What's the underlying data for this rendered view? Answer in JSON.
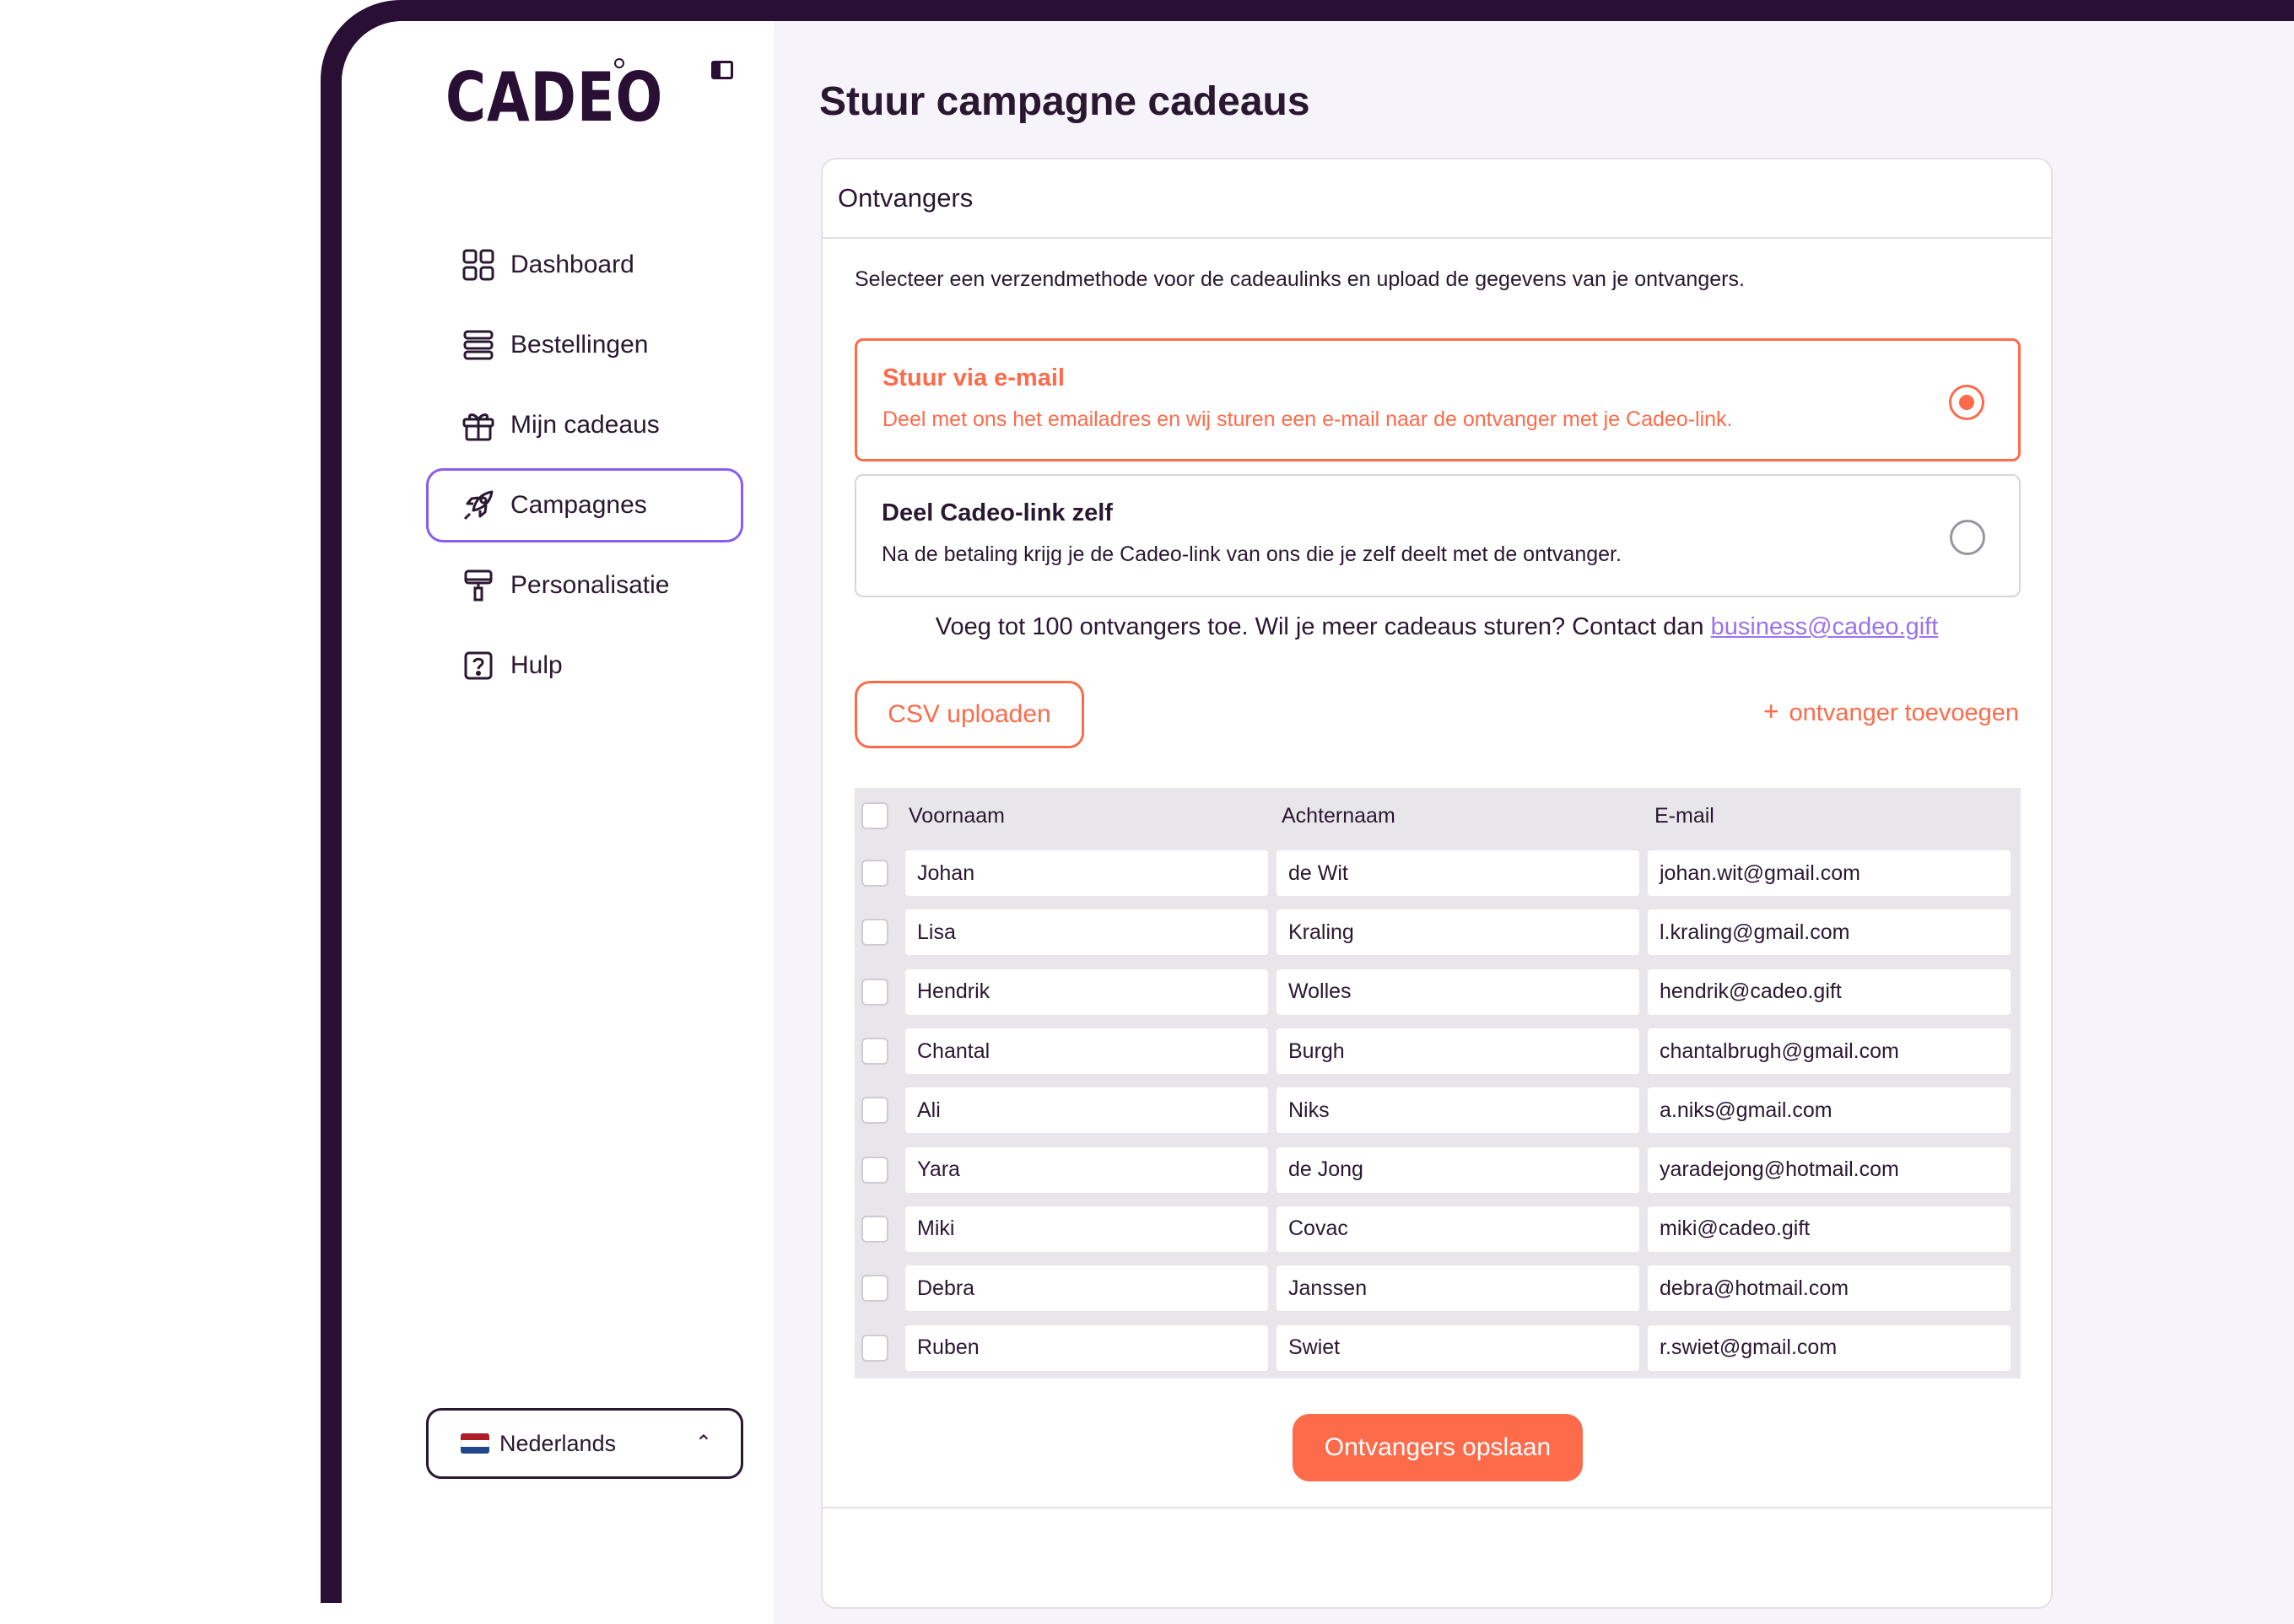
{
  "brand": {
    "logo": "CADEO"
  },
  "sidebar": {
    "items": [
      {
        "label": "Dashboard",
        "icon": "grid-icon"
      },
      {
        "label": "Bestellingen",
        "icon": "list-icon"
      },
      {
        "label": "Mijn cadeaus",
        "icon": "gift-icon"
      },
      {
        "label": "Campagnes",
        "icon": "rocket-icon",
        "active": true
      },
      {
        "label": "Personalisatie",
        "icon": "paint-roller-icon"
      },
      {
        "label": "Hulp",
        "icon": "help-icon"
      }
    ],
    "language": {
      "label": "Nederlands",
      "flag": "netherlands-flag-icon"
    }
  },
  "page": {
    "title": "Stuur campagne cadeaus"
  },
  "card": {
    "title": "Ontvangers",
    "intro": "Selecteer een verzendmethode voor de cadeaulinks en upload de gegevens van je ontvangers.",
    "options": [
      {
        "title": "Stuur via e-mail",
        "description": "Deel met ons het emailadres en wij sturen een e-mail naar de ontvanger met je Cadeo-link.",
        "selected": true
      },
      {
        "title": "Deel Cadeo-link zelf",
        "description": "Na de betaling krijg je de Cadeo-link van ons die je zelf deelt met de ontvanger.",
        "selected": false
      }
    ],
    "limit_text": "Voeg tot 100 ontvangers toe. Wil je meer cadeaus sturen? Contact dan",
    "contact_email": "business@cadeo.gift",
    "csv_button": "CSV uploaden",
    "add_recipient": "ontvanger toevoegen",
    "save_button": "Ontvangers opslaan"
  },
  "table": {
    "columns": [
      "Voornaam",
      "Achternaam",
      "E-mail"
    ],
    "rows": [
      [
        "Johan",
        "de Wit",
        "johan.wit@gmail.com"
      ],
      [
        "Lisa",
        "Kraling",
        "l.kraling@gmail.com"
      ],
      [
        "Hendrik",
        "Wolles",
        "hendrik@cadeo.gift"
      ],
      [
        "Chantal",
        "Burgh",
        "chantalbrugh@gmail.com"
      ],
      [
        "Ali",
        "Niks",
        "a.niks@gmail.com"
      ],
      [
        "Yara",
        "de Jong",
        "yaradejong@hotmail.com"
      ],
      [
        "Miki",
        "Covac",
        "miki@cadeo.gift"
      ],
      [
        "Debra",
        "Janssen",
        "debra@hotmail.com"
      ],
      [
        "Ruben",
        "Swiet",
        "r.swiet@gmail.com"
      ]
    ]
  },
  "colors": {
    "accent": "#fd6b4b",
    "active_nav": "#8a5cf0",
    "link": "#9b72ee",
    "frame": "#2a0f34"
  }
}
